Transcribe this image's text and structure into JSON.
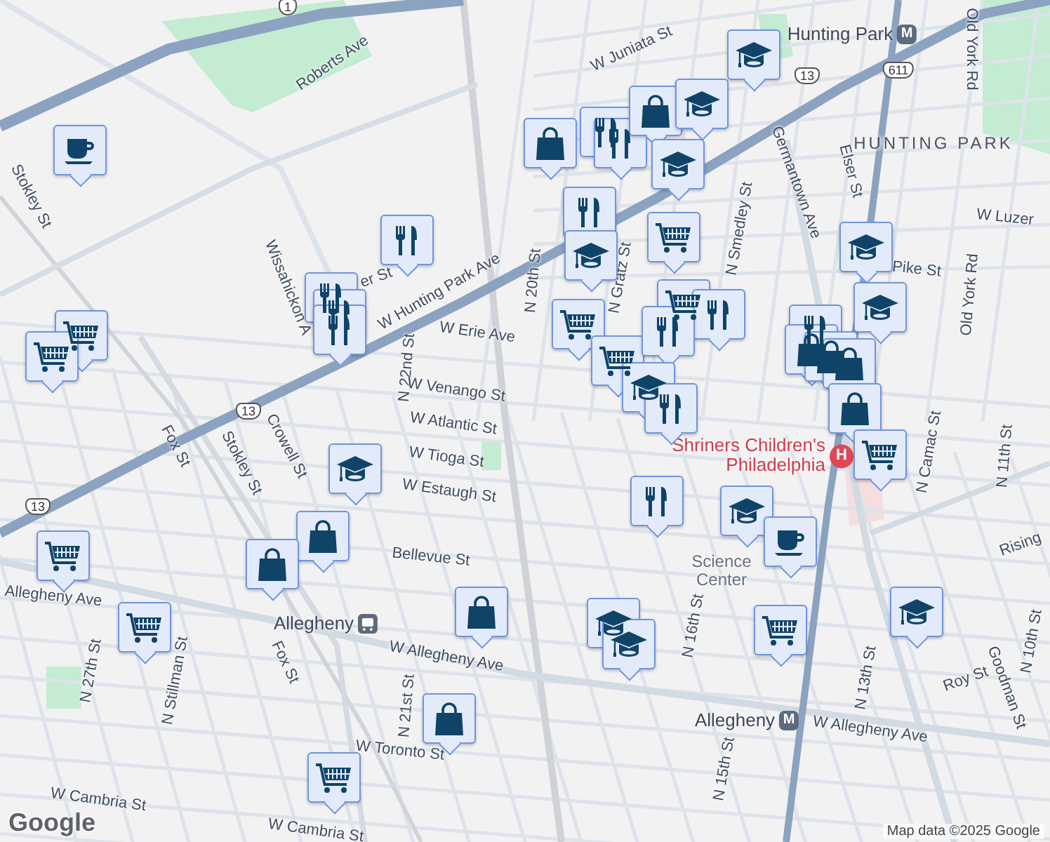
{
  "map": {
    "labels": [
      {
        "text": "Roberts Ave",
        "kind": "street"
      },
      {
        "text": "Stokley St",
        "kind": "street"
      },
      {
        "text": "Wissahickon A",
        "kind": "street"
      },
      {
        "text": "er St",
        "kind": "street"
      },
      {
        "text": "W Hunting Park Ave",
        "kind": "street"
      },
      {
        "text": "W Erie Ave",
        "kind": "street"
      },
      {
        "text": "N 22nd St",
        "kind": "street"
      },
      {
        "text": "W Venango St",
        "kind": "street"
      },
      {
        "text": "W Atlantic St",
        "kind": "street"
      },
      {
        "text": "W Tioga St",
        "kind": "street"
      },
      {
        "text": "W Estaugh St",
        "kind": "street"
      },
      {
        "text": "Crowell St",
        "kind": "street"
      },
      {
        "text": "Stokley St",
        "kind": "street"
      },
      {
        "text": "Fox St",
        "kind": "street"
      },
      {
        "text": "Bellevue St",
        "kind": "street"
      },
      {
        "text": "Allegheny Ave",
        "kind": "street"
      },
      {
        "text": "W Allegheny Ave",
        "kind": "street"
      },
      {
        "text": "N 27th St",
        "kind": "street"
      },
      {
        "text": "N Stillman St",
        "kind": "street"
      },
      {
        "text": "Fox St",
        "kind": "street"
      },
      {
        "text": "N 21st St",
        "kind": "street"
      },
      {
        "text": "W Toronto St",
        "kind": "street"
      },
      {
        "text": "W Cambria St",
        "kind": "street"
      },
      {
        "text": "W Cambria St",
        "kind": "street"
      },
      {
        "text": "W Juniata St",
        "kind": "street"
      },
      {
        "text": "HUNTING PARK",
        "kind": "area"
      },
      {
        "text": "Germantown Ave",
        "kind": "street"
      },
      {
        "text": "Elser St",
        "kind": "street"
      },
      {
        "text": "Old York Rd",
        "kind": "street"
      },
      {
        "text": "W Luzer",
        "kind": "street"
      },
      {
        "text": "Pike St",
        "kind": "street"
      },
      {
        "text": "Old York Rd",
        "kind": "street"
      },
      {
        "text": "N Smedley St",
        "kind": "street"
      },
      {
        "text": "N 20th St",
        "kind": "street"
      },
      {
        "text": "N Gratz St",
        "kind": "street"
      },
      {
        "text": "Science Center",
        "kind": "poi"
      },
      {
        "text": "N 16th St",
        "kind": "street"
      },
      {
        "text": "N 15th St",
        "kind": "street"
      },
      {
        "text": "N 13th St",
        "kind": "street"
      },
      {
        "text": "N Camac St",
        "kind": "street"
      },
      {
        "text": "N 11th St",
        "kind": "street"
      },
      {
        "text": "Roy St",
        "kind": "street"
      },
      {
        "text": "Goodman St",
        "kind": "street"
      },
      {
        "text": "N 10th St",
        "kind": "street"
      },
      {
        "text": "W Allegheny Ave",
        "kind": "street"
      },
      {
        "text": "Rising",
        "kind": "street"
      }
    ],
    "stations": [
      {
        "name": "Hunting Park",
        "kind": "metro",
        "symbol": "M"
      },
      {
        "name": "Shriners Children's Philadelphia",
        "kind": "hospital",
        "symbol": "H"
      },
      {
        "name": "Allegheny",
        "kind": "rail"
      },
      {
        "name": "Allegheny",
        "kind": "metro",
        "symbol": "M"
      }
    ],
    "shields": [
      {
        "text": "1"
      },
      {
        "text": "13"
      },
      {
        "text": "13"
      },
      {
        "text": "13"
      },
      {
        "text": "611"
      }
    ],
    "pins": [
      {
        "kind": "cup"
      },
      {
        "kind": "food"
      },
      {
        "kind": "food"
      },
      {
        "kind": "food"
      },
      {
        "kind": "food"
      },
      {
        "kind": "cart"
      },
      {
        "kind": "cart"
      },
      {
        "kind": "school"
      },
      {
        "kind": "bag"
      },
      {
        "kind": "bag"
      },
      {
        "kind": "cart"
      },
      {
        "kind": "cart"
      },
      {
        "kind": "bag"
      },
      {
        "kind": "bag"
      },
      {
        "kind": "cart"
      },
      {
        "kind": "bag"
      },
      {
        "kind": "food"
      },
      {
        "kind": "food"
      },
      {
        "kind": "bag"
      },
      {
        "kind": "school"
      },
      {
        "kind": "school"
      },
      {
        "kind": "school"
      },
      {
        "kind": "food"
      },
      {
        "kind": "school"
      },
      {
        "kind": "cart"
      },
      {
        "kind": "cart"
      },
      {
        "kind": "cart"
      },
      {
        "kind": "cart"
      },
      {
        "kind": "food"
      },
      {
        "kind": "food"
      },
      {
        "kind": "school"
      },
      {
        "kind": "food"
      },
      {
        "kind": "food"
      },
      {
        "kind": "school"
      },
      {
        "kind": "school"
      },
      {
        "kind": "food"
      },
      {
        "kind": "bag"
      },
      {
        "kind": "bag"
      },
      {
        "kind": "bag"
      },
      {
        "kind": "bag"
      },
      {
        "kind": "school"
      },
      {
        "kind": "cup"
      },
      {
        "kind": "cart"
      },
      {
        "kind": "school"
      },
      {
        "kind": "school"
      },
      {
        "kind": "cart"
      },
      {
        "kind": "school"
      }
    ],
    "attribution": "Map data ©2025 Google",
    "logo": "Google"
  }
}
